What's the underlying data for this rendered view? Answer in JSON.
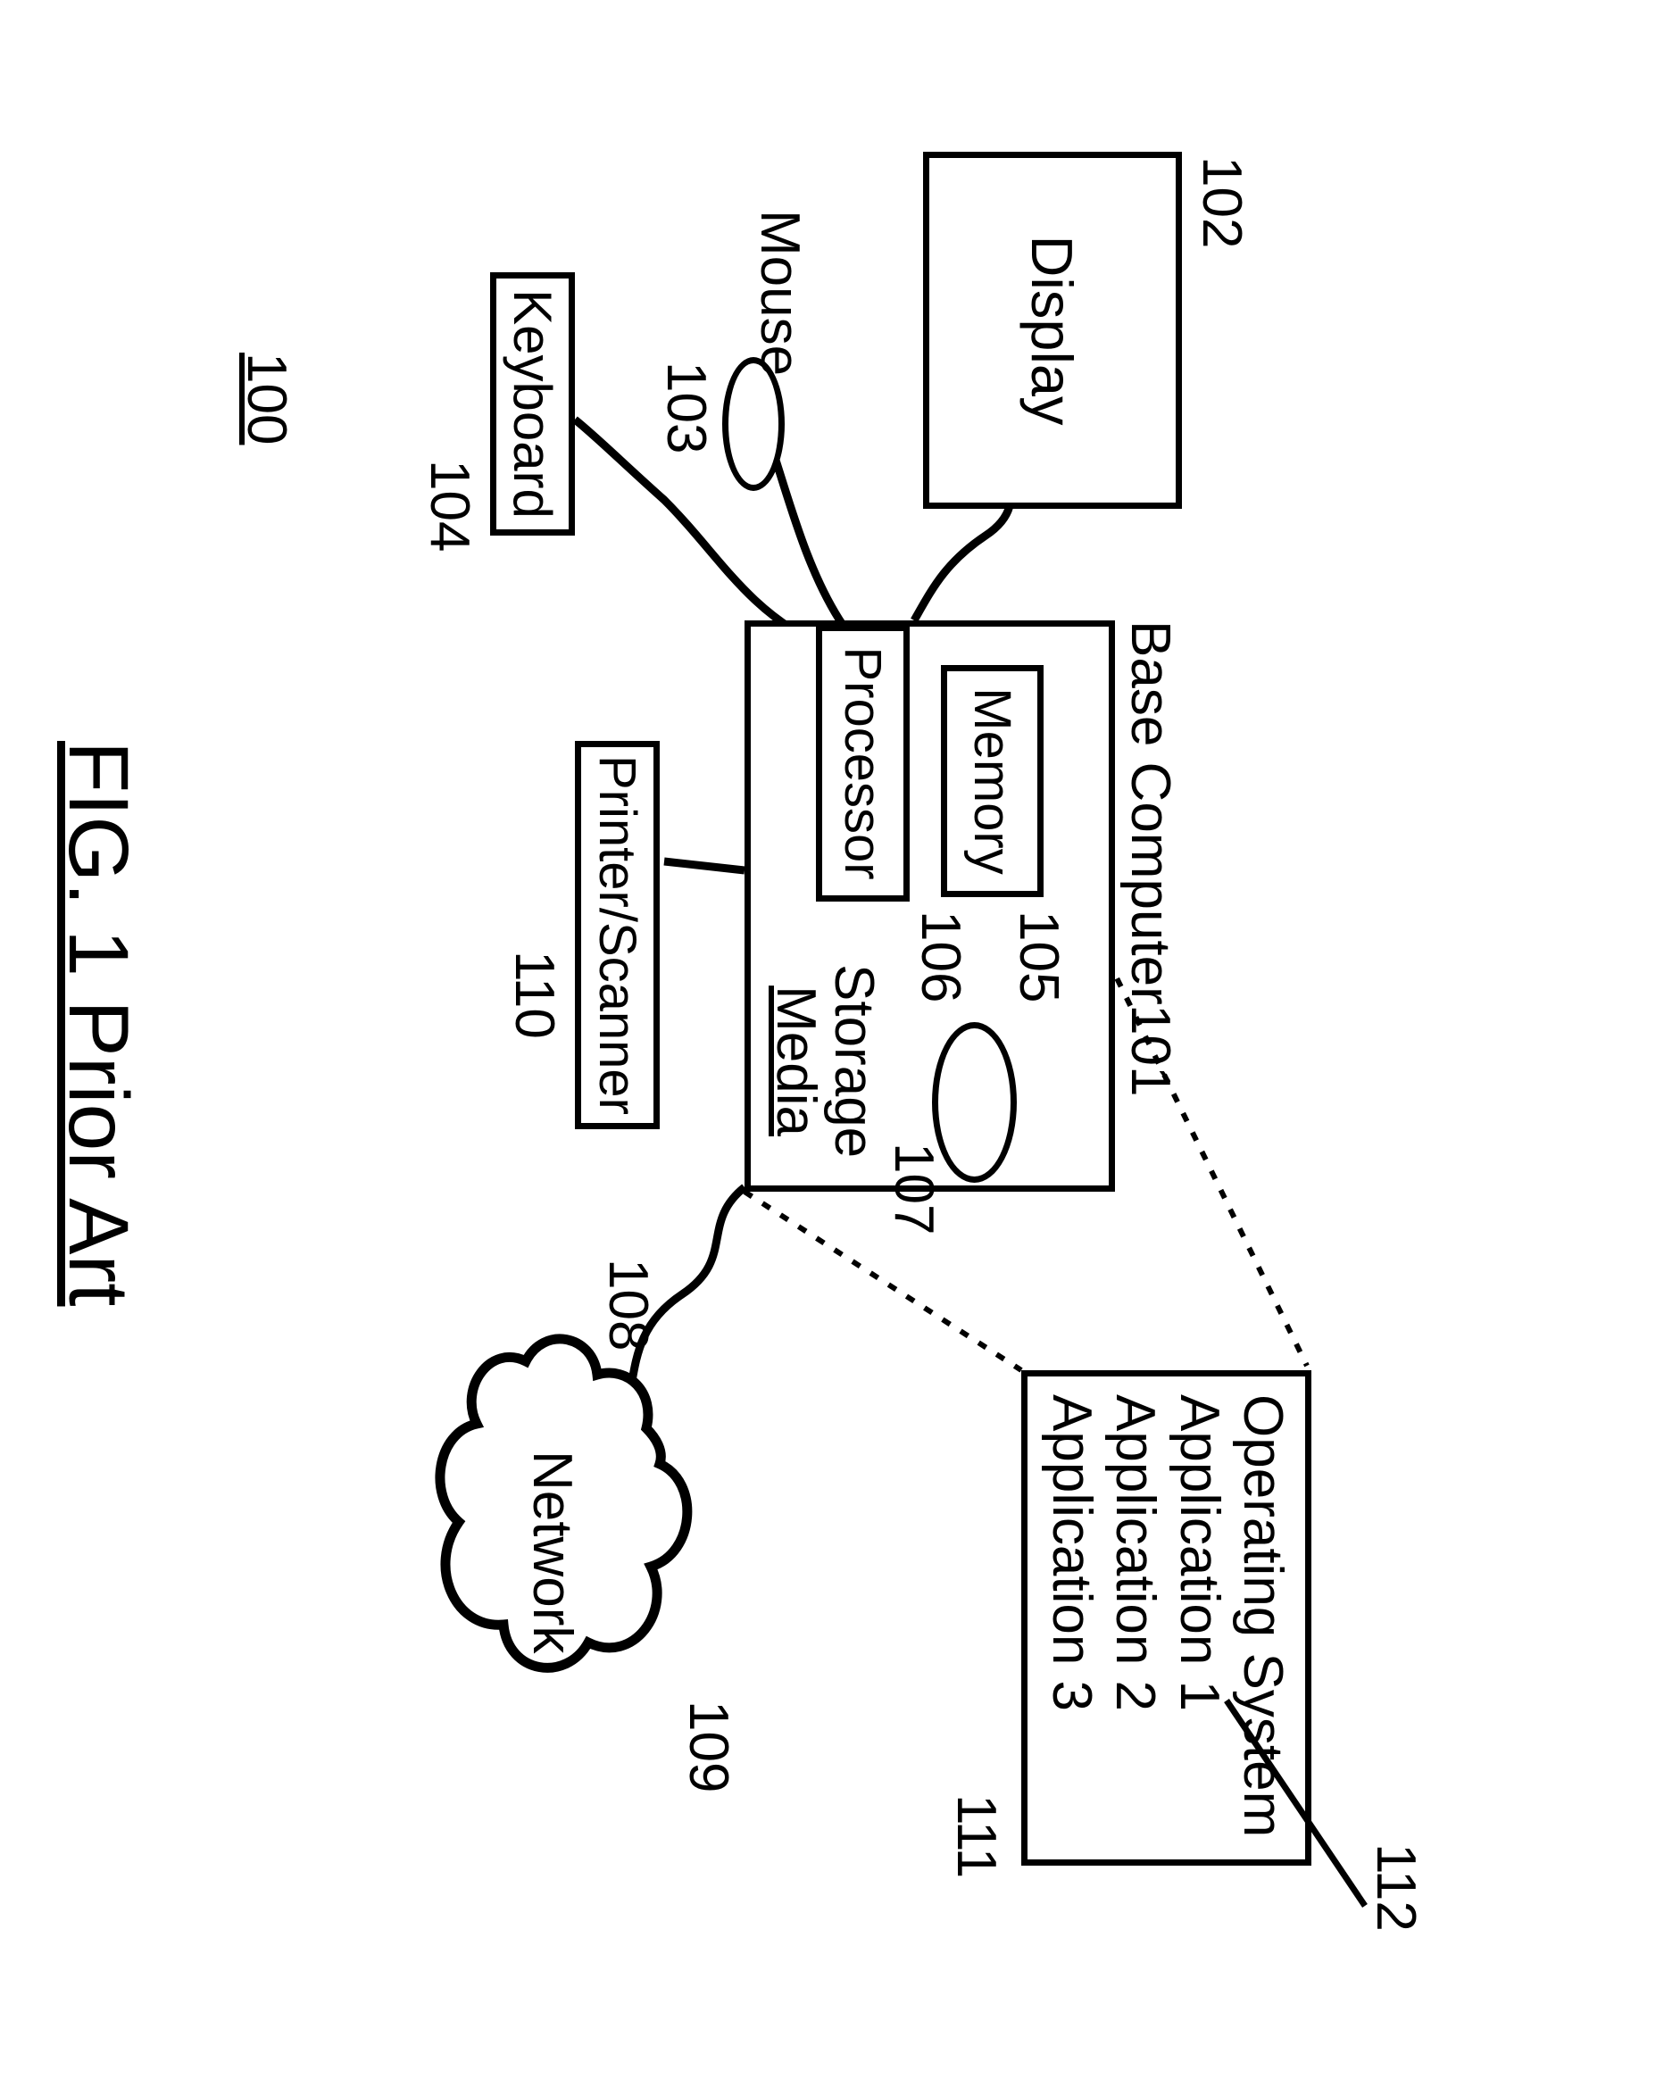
{
  "figure_title": "FIG. 1 Prior Art",
  "system_label": "100",
  "computer": {
    "title": "Base Computer",
    "ref": "101",
    "memory": {
      "label": "Memory",
      "ref": "105"
    },
    "processor": {
      "label": "Processor",
      "ref": "106"
    },
    "storage": {
      "label": "Storage",
      "label2": "Media",
      "ref": "107"
    }
  },
  "display": {
    "label": "Display",
    "ref": "102"
  },
  "mouse": {
    "label": "Mouse",
    "ref": "103"
  },
  "keyboard": {
    "label": "Keyboard",
    "ref": "104"
  },
  "printer": {
    "label": "Printer/Scanner",
    "ref": "110"
  },
  "network_if_ref": "108",
  "network": {
    "label": "Network",
    "ref": "109"
  },
  "software": {
    "ref_box": "111",
    "ref_app": "112",
    "lines": [
      "Operating System",
      "Application 1",
      "Application 2",
      "Application 3"
    ]
  }
}
